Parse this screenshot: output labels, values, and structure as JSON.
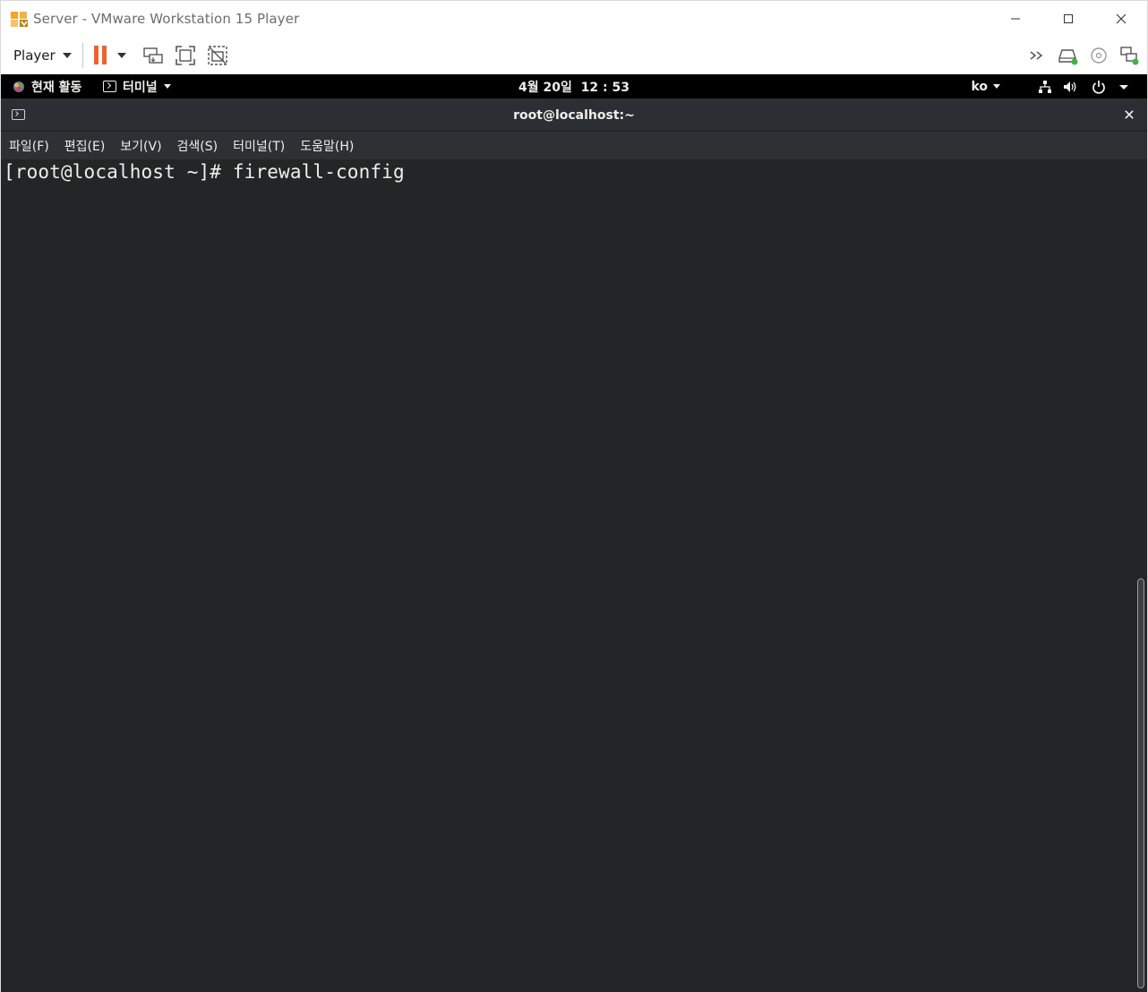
{
  "vm_window": {
    "title": "Server - VMware Workstation 15 Player",
    "player_menu_label": "Player",
    "icons": {
      "logo": "vmware-player-logo-icon",
      "pause": "pause-icon",
      "send_ctrl_alt_del": "send-ctrl-alt-del-icon",
      "full_screen": "full-screen-icon",
      "unity": "unity-icon",
      "more": "double-chevron-right-icon",
      "hdd": "hard-disk-icon",
      "cd": "cd-dvd-icon",
      "network": "network-adapter-icon",
      "minimize": "minimize-icon",
      "maximize": "maximize-icon",
      "close": "close-icon"
    },
    "colors": {
      "pause_accent": "#f0622b",
      "status_green": "#3fb53f"
    }
  },
  "gnome_top_bar": {
    "activities_label": "현재 활동",
    "app_menu_label": "터미널",
    "clock": "4월 20일  12 : 53",
    "input_language": "ko",
    "tray_icons": [
      "network-wired-icon",
      "volume-icon",
      "power-icon",
      "chevron-down-icon"
    ]
  },
  "terminal": {
    "window_title": "root@localhost:~",
    "close_glyph": "×",
    "menus": [
      "파일(F)",
      "편집(E)",
      "보기(V)",
      "검색(S)",
      "터미널(T)",
      "도움말(H)"
    ],
    "prompt": "[root@localhost ~]#",
    "command": "firewall-config",
    "colors": {
      "background": "#232627",
      "text": "#eeeeec"
    }
  }
}
